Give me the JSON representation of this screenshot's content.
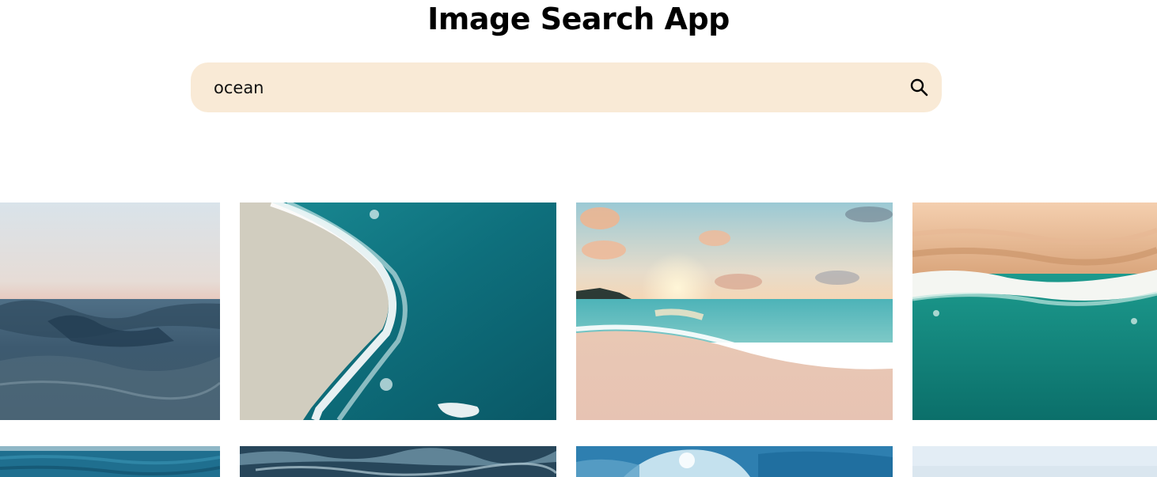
{
  "app": {
    "title": "Image Search App"
  },
  "search": {
    "value": "ocean",
    "button_icon": "search-icon"
  },
  "results": [
    {
      "row": 1,
      "col": 1,
      "subject": "calm-ocean-surface"
    },
    {
      "row": 1,
      "col": 2,
      "subject": "aerial-beach-waves"
    },
    {
      "row": 1,
      "col": 3,
      "subject": "beach-sunset"
    },
    {
      "row": 1,
      "col": 4,
      "subject": "aerial-sand-shoreline"
    },
    {
      "row": 2,
      "col": 1,
      "subject": "ocean-horizon"
    },
    {
      "row": 2,
      "col": 2,
      "subject": "dark-foamy-water"
    },
    {
      "row": 2,
      "col": 3,
      "subject": "crashing-wave"
    },
    {
      "row": 2,
      "col": 4,
      "subject": "pale-sky"
    }
  ],
  "colors": {
    "search_bg": "#f9ead6",
    "title": "#000000"
  }
}
